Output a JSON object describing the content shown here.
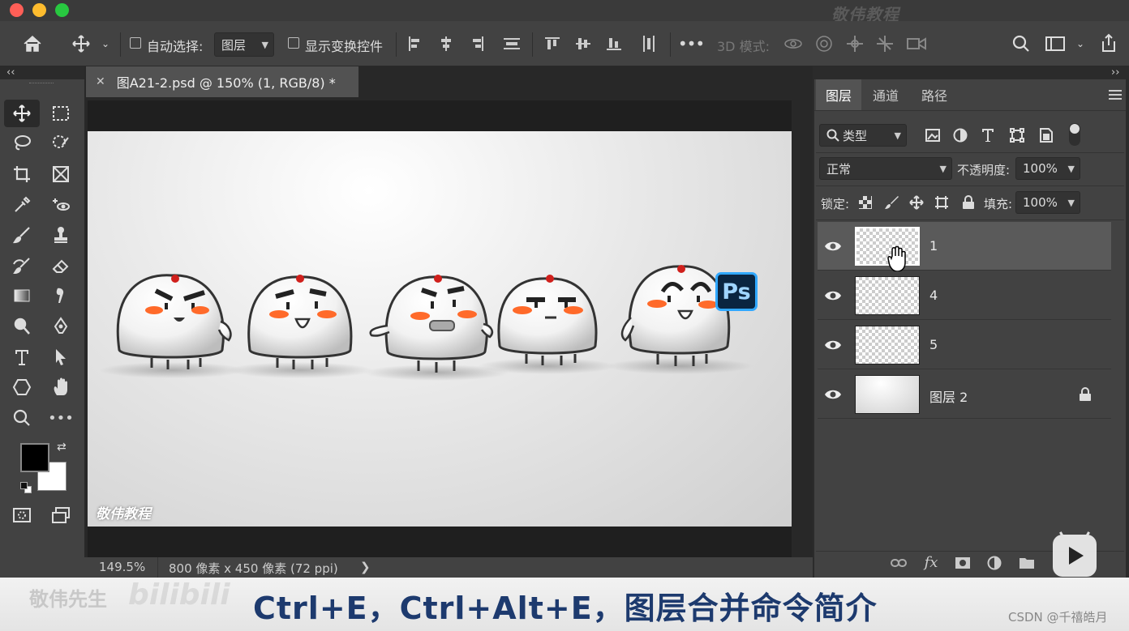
{
  "window": {
    "watermark_top": "敬伟教程"
  },
  "options_bar": {
    "auto_select_label": "自动选择:",
    "auto_select_value": "图层",
    "show_transform_label": "显示变换控件",
    "three_d_mode_label": "3D 模式:"
  },
  "document": {
    "tab_title": "图A21-2.psd @ 150% (1, RGB/8) *",
    "canvas_watermark": "敬伟教程",
    "ps_badge": "Ps"
  },
  "status_bar": {
    "zoom": "149.5%",
    "doc_info": "800 像素 x 450 像素 (72 ppi)",
    "arrow": "❯"
  },
  "layers_panel": {
    "tabs": [
      "图层",
      "通道",
      "路径"
    ],
    "filter_value": "类型",
    "blend_mode": "正常",
    "opacity_label": "不透明度:",
    "opacity_value": "100%",
    "lock_label": "锁定:",
    "fill_label": "填充:",
    "fill_value": "100%",
    "layers": [
      {
        "name": "1",
        "selected": true,
        "locked": false
      },
      {
        "name": "4",
        "selected": false,
        "locked": false
      },
      {
        "name": "5",
        "selected": false,
        "locked": false
      },
      {
        "name": "图层 2",
        "selected": false,
        "locked": true
      }
    ],
    "footer_fx": "fx"
  },
  "video_overlay": {
    "subtitle": "Ctrl+E，Ctrl+Alt+E，图层合并命令简介",
    "brand": "敬伟先生",
    "bilibili": "bilibili",
    "csdn": "CSDN @千禧皓月"
  },
  "colors": {
    "panel_bg": "#424242",
    "selected_layer": "#5a5a5a",
    "subtitle_color": "#1d3a6e",
    "ps_badge_bg": "#0a2540",
    "ps_badge_border": "#31a8ff",
    "cheek": "#ff6a2a",
    "head_dot": "#d0201c"
  }
}
